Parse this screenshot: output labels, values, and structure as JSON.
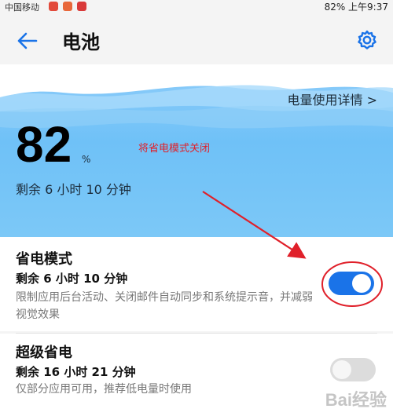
{
  "status_bar": {
    "carrier": "中国移动",
    "right_text": "82% 上午9:37"
  },
  "app_bar": {
    "title": "电池"
  },
  "hero": {
    "usage_details_link": "电量使用详情 >",
    "battery_percent": "82",
    "percent_unit": "%",
    "remaining": "剩余 6 小时 10 分钟"
  },
  "annotation": {
    "text": "将省电模式关闭",
    "color": "#e0202a"
  },
  "power_saving": {
    "title": "省电模式",
    "remaining": "剩余 6 小时 10 分钟",
    "description": "限制应用后台活动、关闭邮件自动同步和系统提示音，并减弱视觉效果",
    "enabled": true
  },
  "ultra_power_saving": {
    "title": "超级省电",
    "remaining": "剩余 16 小时 21 分钟",
    "description": "仅部分应用可用，推荐低电量时使用",
    "enabled": false
  },
  "watermark": {
    "text": "Bai经验"
  },
  "colors": {
    "accent": "#1a73e8",
    "hero_top": "#8fcdfa",
    "hero_bottom": "#7cc8f7"
  }
}
